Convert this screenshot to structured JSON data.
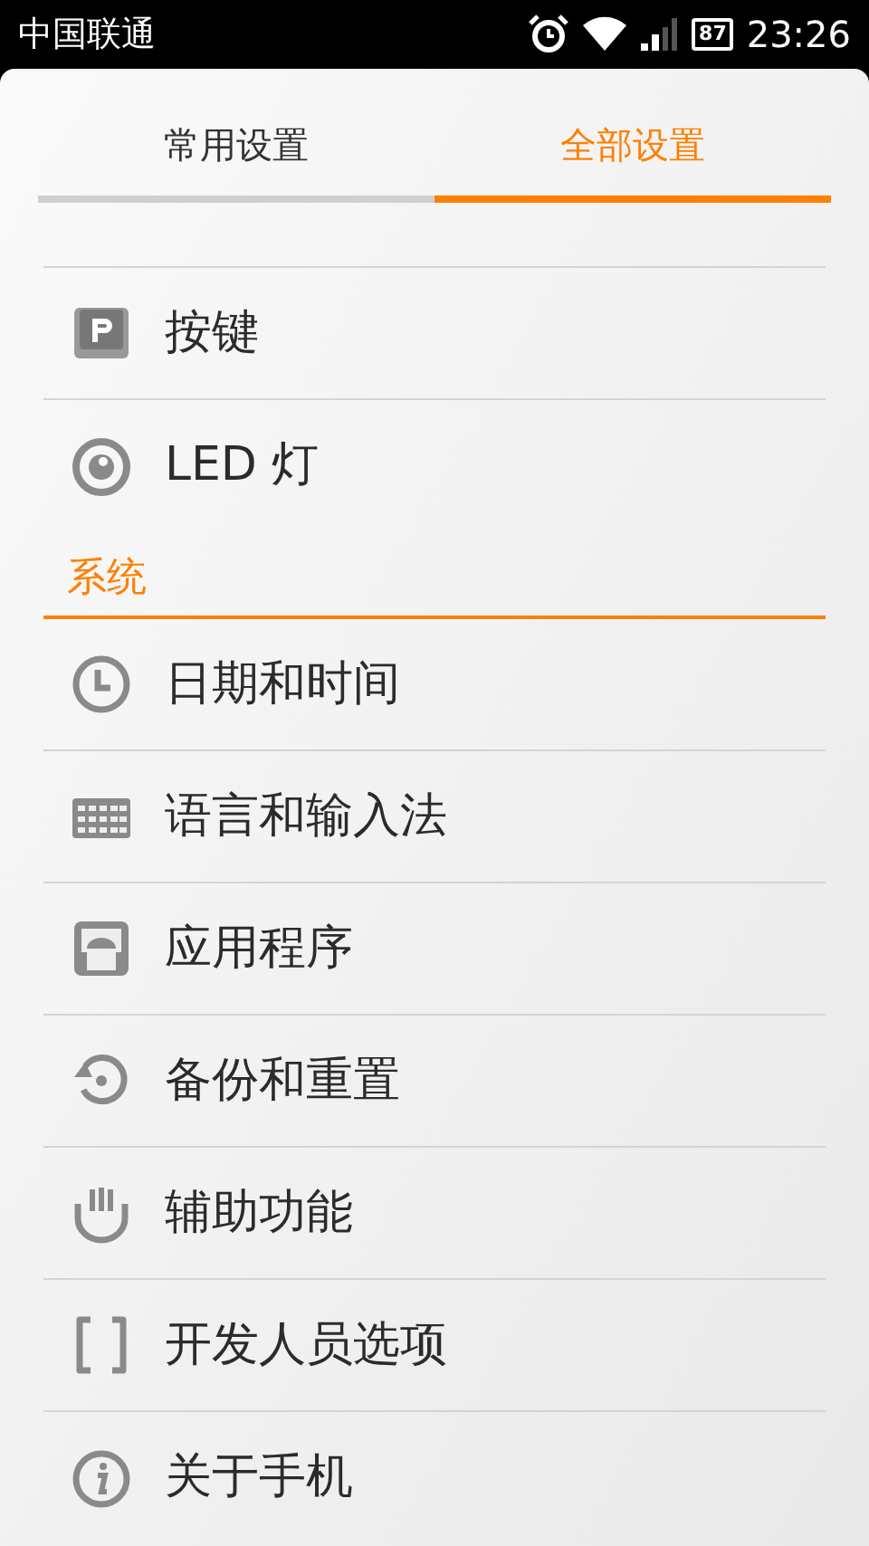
{
  "status_bar": {
    "carrier": "中国联通",
    "battery": "87",
    "time": "23:26"
  },
  "tabs": [
    {
      "label": "常用设置",
      "selected": false
    },
    {
      "label": "全部设置",
      "selected": true
    }
  ],
  "sections": [
    {
      "items": [
        {
          "kind": "key",
          "label": "按键"
        },
        {
          "kind": "led",
          "label": "LED 灯"
        }
      ]
    },
    {
      "title": "系统",
      "items": [
        {
          "kind": "clock",
          "label": "日期和时间"
        },
        {
          "kind": "keyboard",
          "label": "语言和输入法"
        },
        {
          "kind": "android",
          "label": "应用程序"
        },
        {
          "kind": "backup",
          "label": "备份和重置"
        },
        {
          "kind": "hand",
          "label": "辅助功能"
        },
        {
          "kind": "brackets",
          "label": "开发人员选项"
        },
        {
          "kind": "info",
          "label": "关于手机"
        }
      ]
    }
  ]
}
